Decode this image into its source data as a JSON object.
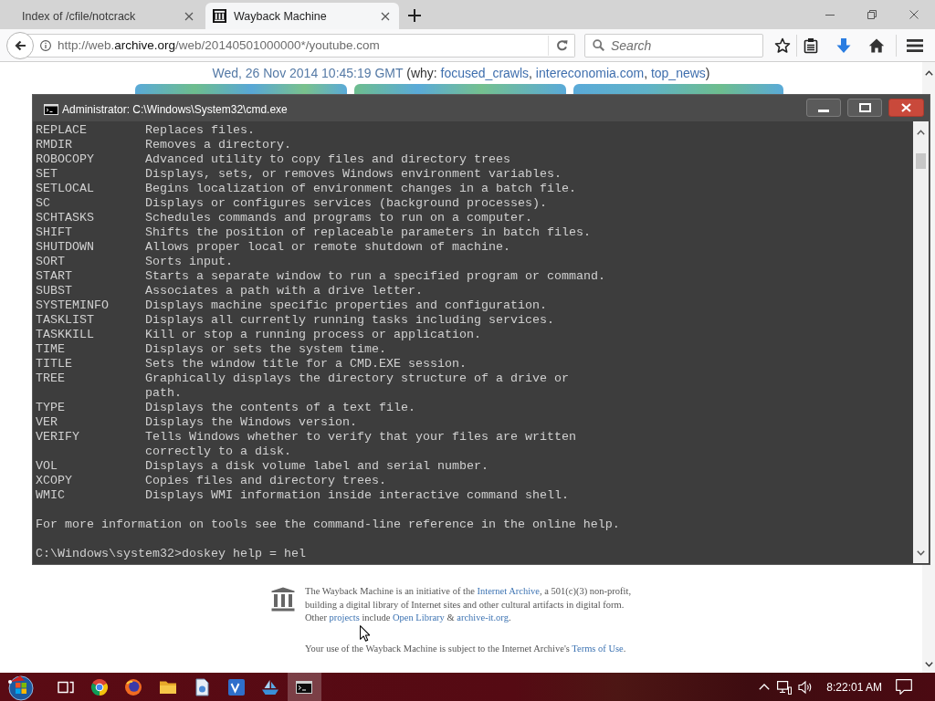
{
  "browser": {
    "tabs": [
      {
        "title": "Index of /cfile/notcrack",
        "favicon": false,
        "selected": false
      },
      {
        "title": "Wayback Machine",
        "favicon": true,
        "selected": true
      }
    ],
    "address": {
      "prefix": "http://web.",
      "domain": "archive.org",
      "path": "/web/20140501000000*/youtube.com"
    },
    "search": {
      "placeholder": "Search"
    }
  },
  "page": {
    "capture_line": [
      {
        "kind": "date",
        "text": "Wed, 26 Nov 2014 10:45:19 GMT"
      },
      {
        "kind": "plain",
        "text": " (why: "
      },
      {
        "kind": "link",
        "text": "focused_crawls"
      },
      {
        "kind": "plain",
        "text": ", "
      },
      {
        "kind": "link",
        "text": "intereconomia.com"
      },
      {
        "kind": "plain",
        "text": ", "
      },
      {
        "kind": "link",
        "text": "top_news"
      },
      {
        "kind": "plain",
        "text": ")"
      }
    ],
    "footer": {
      "paragraphs": [
        {
          "lines": [
            [
              {
                "kind": "plain",
                "text": "The Wayback Machine is an initiative of the "
              },
              {
                "kind": "link",
                "text": "Internet Archive"
              },
              {
                "kind": "plain",
                "text": ", a 501(c)(3) non-profit,"
              }
            ],
            [
              {
                "kind": "plain",
                "text": "building a digital library of Internet sites and other cultural artifacts in digital form."
              }
            ],
            [
              {
                "kind": "plain",
                "text": "Other "
              },
              {
                "kind": "link",
                "text": "projects"
              },
              {
                "kind": "plain",
                "text": " include "
              },
              {
                "kind": "link",
                "text": "Open Library"
              },
              {
                "kind": "plain",
                "text": " & "
              },
              {
                "kind": "link",
                "text": "archive-it.org"
              },
              {
                "kind": "plain",
                "text": "."
              }
            ]
          ]
        },
        {
          "lines": [
            [
              {
                "kind": "plain",
                "text": "Your use of the Wayback Machine is subject to the Internet Archive's "
              },
              {
                "kind": "link",
                "text": "Terms of Use"
              },
              {
                "kind": "plain",
                "text": "."
              }
            ]
          ]
        }
      ]
    }
  },
  "console": {
    "title": "Administrator: C:\\Windows\\System32\\cmd.exe",
    "commands": [
      {
        "name": "REPLACE",
        "description": "Replaces files."
      },
      {
        "name": "RMDIR",
        "description": "Removes a directory."
      },
      {
        "name": "ROBOCOPY",
        "description": "Advanced utility to copy files and directory trees"
      },
      {
        "name": "SET",
        "description": "Displays, sets, or removes Windows environment variables."
      },
      {
        "name": "SETLOCAL",
        "description": "Begins localization of environment changes in a batch file."
      },
      {
        "name": "SC",
        "description": "Displays or configures services (background processes)."
      },
      {
        "name": "SCHTASKS",
        "description": "Schedules commands and programs to run on a computer."
      },
      {
        "name": "SHIFT",
        "description": "Shifts the position of replaceable parameters in batch files."
      },
      {
        "name": "SHUTDOWN",
        "description": "Allows proper local or remote shutdown of machine."
      },
      {
        "name": "SORT",
        "description": "Sorts input."
      },
      {
        "name": "START",
        "description": "Starts a separate window to run a specified program or command."
      },
      {
        "name": "SUBST",
        "description": "Associates a path with a drive letter."
      },
      {
        "name": "SYSTEMINFO",
        "description": "Displays machine specific properties and configuration."
      },
      {
        "name": "TASKLIST",
        "description": "Displays all currently running tasks including services."
      },
      {
        "name": "TASKKILL",
        "description": "Kill or stop a running process or application."
      },
      {
        "name": "TIME",
        "description": "Displays or sets the system time."
      },
      {
        "name": "TITLE",
        "description": "Sets the window title for a CMD.EXE session."
      },
      {
        "name": "TREE",
        "description": "Graphically displays the directory structure of a drive or\npath."
      },
      {
        "name": "TYPE",
        "description": "Displays the contents of a text file."
      },
      {
        "name": "VER",
        "description": "Displays the Windows version."
      },
      {
        "name": "VERIFY",
        "description": "Tells Windows whether to verify that your files are written\ncorrectly to a disk."
      },
      {
        "name": "VOL",
        "description": "Displays a disk volume label and serial number."
      },
      {
        "name": "XCOPY",
        "description": "Copies files and directory trees."
      },
      {
        "name": "WMIC",
        "description": "Displays WMI information inside interactive command shell."
      }
    ],
    "note": "For more information on tools see the command-line reference in the online help.",
    "prompt": "C:\\Windows\\system32>doskey help = hel"
  },
  "taskbar": {
    "apps": [
      {
        "kind": "task_view",
        "selected": false
      },
      {
        "kind": "round_browser",
        "selected": false
      },
      {
        "kind": "globe_browser",
        "selected": false
      },
      {
        "kind": "folder",
        "selected": false
      },
      {
        "kind": "document_app",
        "selected": false
      },
      {
        "kind": "tile_app",
        "selected": false
      },
      {
        "kind": "boat_app",
        "selected": false
      },
      {
        "kind": "terminal",
        "selected": true
      }
    ],
    "clock": "8:22:01 AM"
  }
}
